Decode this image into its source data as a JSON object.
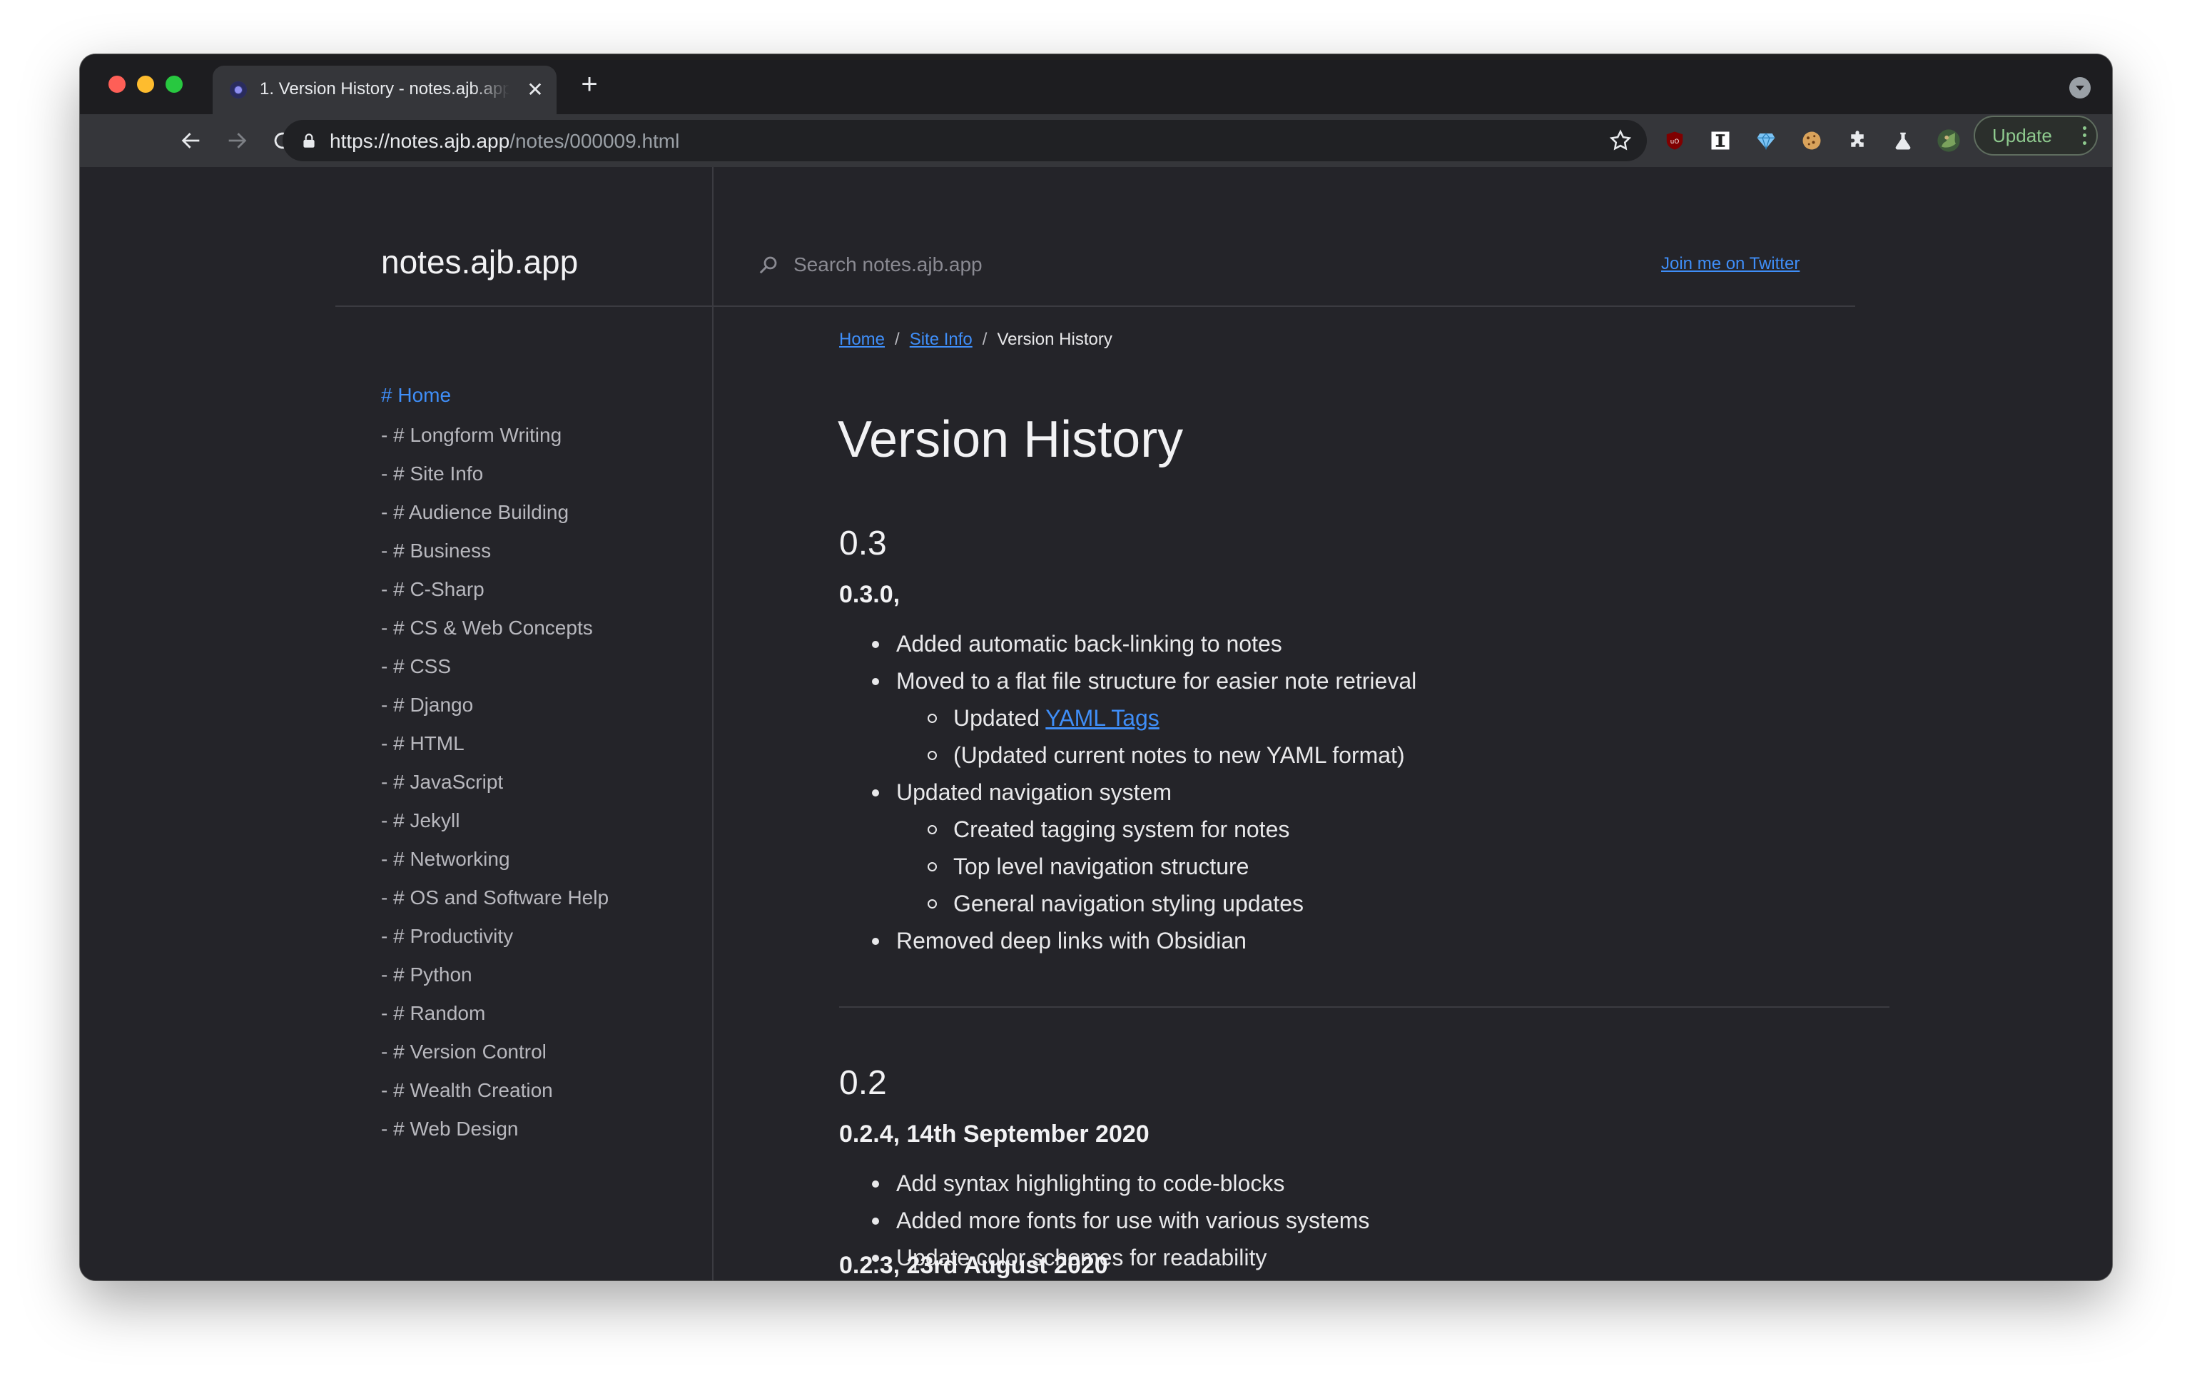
{
  "browser": {
    "tab_title": "1. Version History - notes.ajb.app",
    "tab_close": "✕",
    "new_tab": "+",
    "url_host": "https://notes.ajb.app",
    "url_path": "/notes/000009.html",
    "update_label": "Update",
    "extensions": [
      "ublock-icon",
      "instapaper-icon",
      "diamond-icon",
      "cookie-icon",
      "puzzle-icon",
      "flask-icon",
      "profile-avatar"
    ]
  },
  "site": {
    "title": "notes.ajb.app",
    "search_placeholder": "Search notes.ajb.app",
    "twitter_link": "Join me on Twitter"
  },
  "sidebar": {
    "home": "# Home",
    "items": [
      "- # Longform Writing",
      "- # Site Info",
      "- # Audience Building",
      "- # Business",
      "- # C-Sharp",
      "- # CS & Web Concepts",
      "- # CSS",
      "- # Django",
      "- # HTML",
      "- # JavaScript",
      "- # Jekyll",
      "- # Networking",
      "- # OS and Software Help",
      "- # Productivity",
      "- # Python",
      "- # Random",
      "- # Version Control",
      "- # Wealth Creation",
      "- # Web Design"
    ]
  },
  "breadcrumb": {
    "home": "Home",
    "site_info": "Site Info",
    "current": "Version History",
    "separator": "/"
  },
  "content": {
    "title": "Version History",
    "sections": [
      {
        "heading": "0.3",
        "releases": [
          {
            "heading": "0.3.0,",
            "items": [
              {
                "text": "Added automatic back-linking to notes"
              },
              {
                "text": "Moved to a flat file structure for easier note retrieval"
              },
              {
                "text": "Updated ",
                "link": "YAML Tags",
                "sub": true
              },
              {
                "text": "(Updated current notes to new YAML format)",
                "sub": true
              },
              {
                "text": "Updated navigation system"
              },
              {
                "text": "Created tagging system for notes",
                "sub": true
              },
              {
                "text": "Top level navigation structure",
                "sub": true
              },
              {
                "text": "General navigation styling updates",
                "sub": true
              },
              {
                "text": "Removed deep links with Obsidian"
              }
            ]
          }
        ]
      },
      {
        "heading": "0.2",
        "releases": [
          {
            "heading": "0.2.4, 14th September 2020",
            "items": [
              {
                "text": "Add syntax highlighting to code-blocks"
              },
              {
                "text": "Added more fonts for use with various systems"
              },
              {
                "text": "Update color schemes for readability"
              }
            ]
          },
          {
            "heading": "0.2.3, 23rd August 2020",
            "items": []
          }
        ]
      }
    ]
  },
  "colors": {
    "page_bg": "#242429",
    "link": "#3f8ef8",
    "text": "#e8e8ea",
    "muted": "#b8b8be"
  }
}
